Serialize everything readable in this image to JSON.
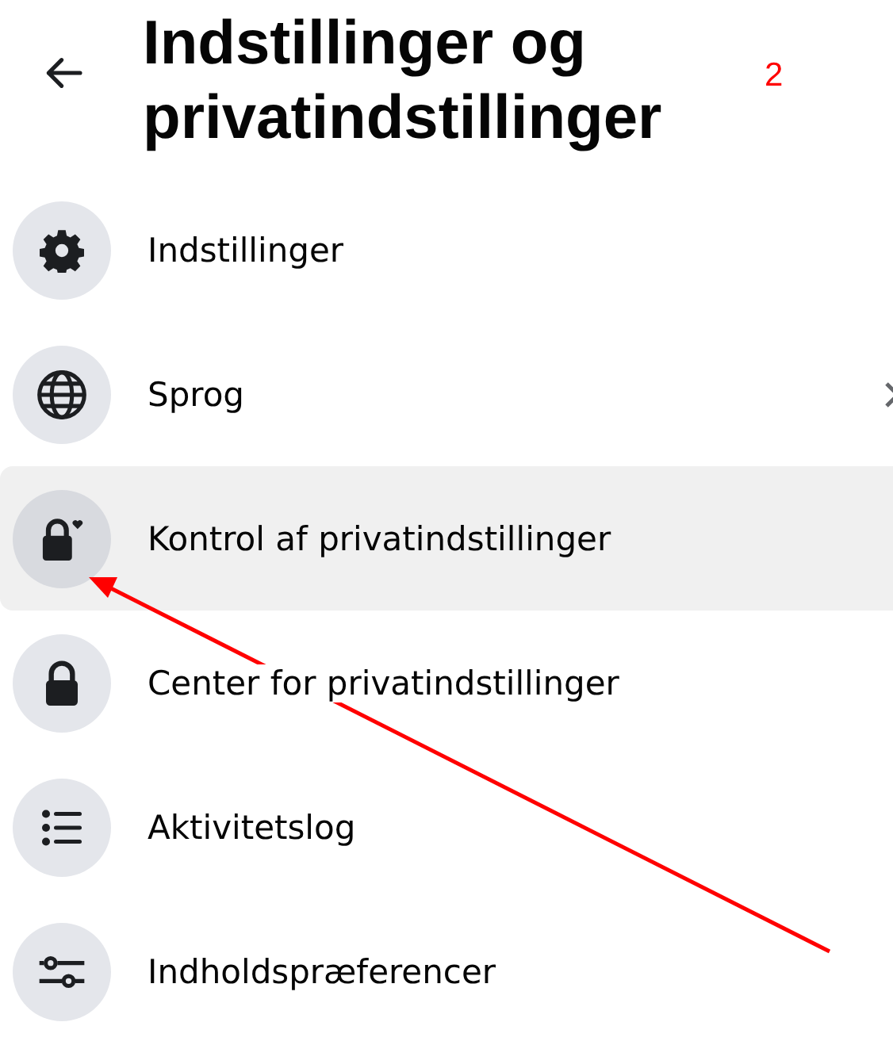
{
  "header": {
    "title": "Indstillinger og privatindstillinger"
  },
  "annotation": {
    "number": "2"
  },
  "items": [
    {
      "label": "Indstillinger",
      "kind": "gear",
      "selected": false,
      "chevron": false
    },
    {
      "label": "Sprog",
      "kind": "globe",
      "selected": false,
      "chevron": true
    },
    {
      "label": "Kontrol af privatindstillinger",
      "kind": "lock-heart",
      "selected": true,
      "chevron": false
    },
    {
      "label": "Center for privatindstillinger",
      "kind": "lock",
      "selected": false,
      "chevron": false
    },
    {
      "label": "Aktivitetslog",
      "kind": "list",
      "selected": false,
      "chevron": false
    },
    {
      "label": "Indholdspræferencer",
      "kind": "sliders",
      "selected": false,
      "chevron": false
    }
  ]
}
